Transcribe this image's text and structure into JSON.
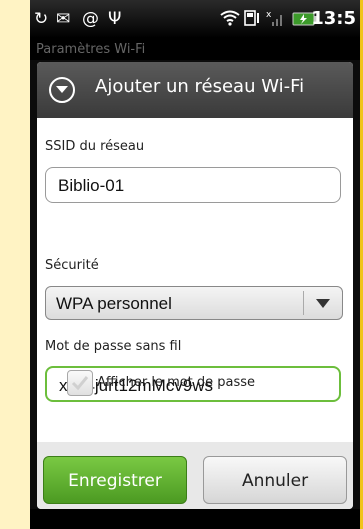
{
  "status_bar": {
    "time": "13:5",
    "icons": [
      "sync-icon",
      "mail-icon",
      "at-icon",
      "usb-icon",
      "wifi-icon",
      "storage-icon",
      "signal-icon",
      "battery-icon"
    ]
  },
  "background": {
    "title": "Paramètres Wi-Fi"
  },
  "dialog": {
    "title": "Ajouter un réseau Wi-Fi",
    "ssid_label": "SSID du réseau",
    "ssid_value": "Biblio-01",
    "security_label": "Sécurité",
    "security_value": "WPA personnel",
    "password_label": "Mot de passe sans fil",
    "password_value": "xc24jurt12mMcv9ws",
    "show_password_label": "Afficher le mot de passe",
    "save_label": "Enregistrer",
    "cancel_label": "Annuler"
  },
  "colors": {
    "accent": "#6cbe3c",
    "frame": "#f0c419"
  }
}
